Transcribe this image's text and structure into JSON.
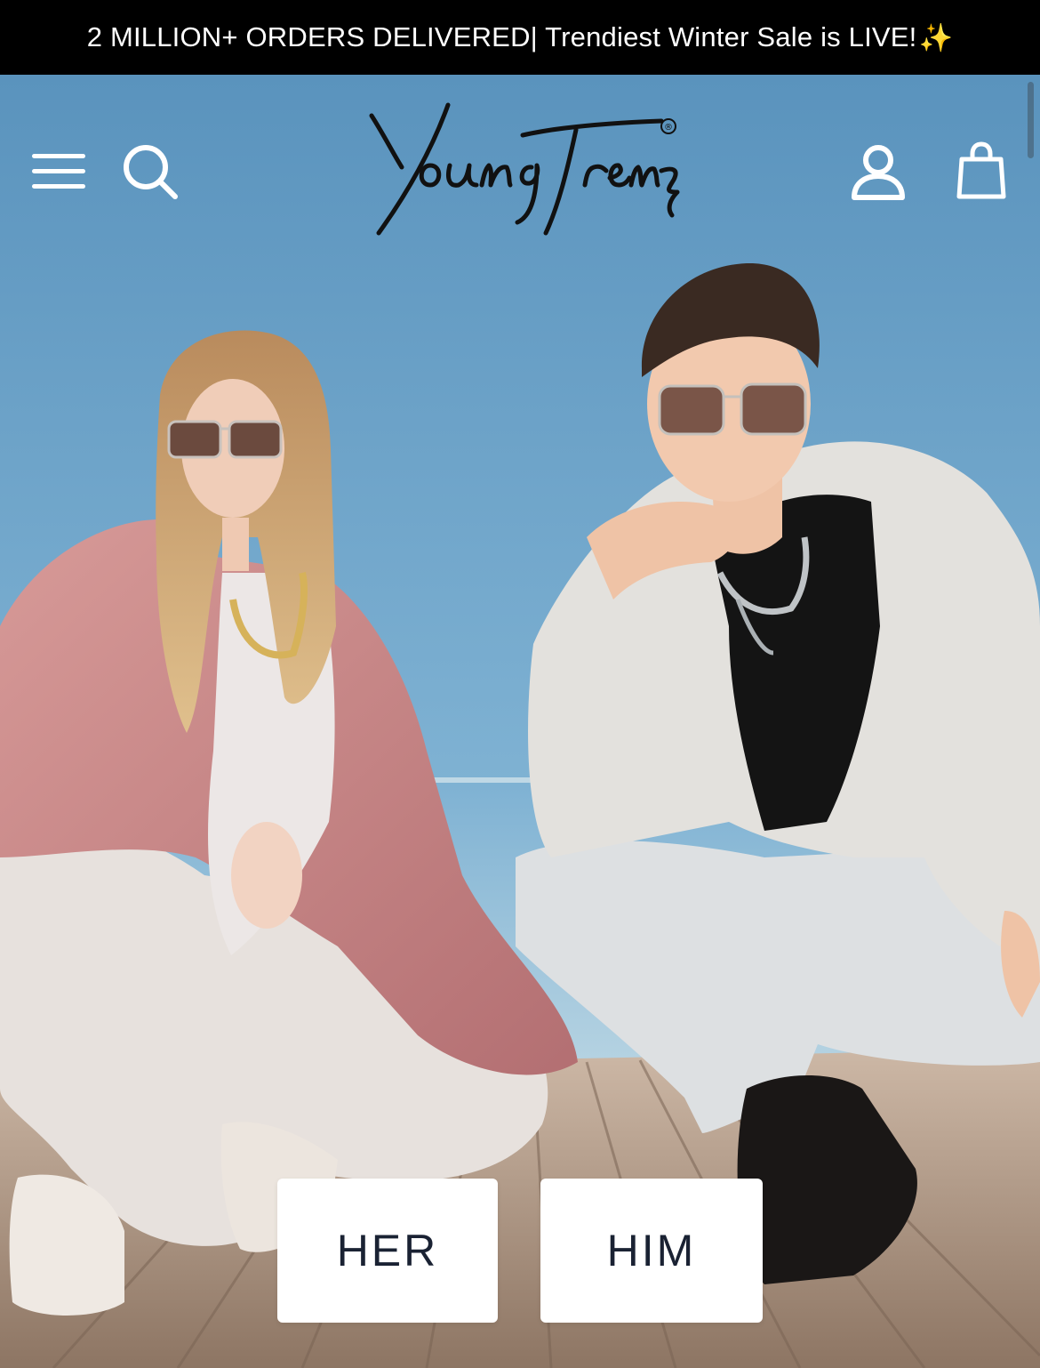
{
  "announcement": {
    "text": "2 MILLION+ ORDERS DELIVERED| Trendiest Winter Sale is LIVE!",
    "sparkle": "✨"
  },
  "header": {
    "menu_icon": "hamburger-menu-icon",
    "search_icon": "search-icon",
    "logo_text": "YoungTrendz",
    "logo_mark": "®",
    "account_icon": "user-account-icon",
    "cart_icon": "shopping-bag-icon"
  },
  "hero": {
    "cta_her": "HER",
    "cta_him": "HIM"
  },
  "colors": {
    "announcement_bg": "#000000",
    "sky_top": "#5b93bd",
    "sky_bottom": "#c9dfe9",
    "deck": "#b69e8a",
    "button_text": "#1a2233"
  }
}
